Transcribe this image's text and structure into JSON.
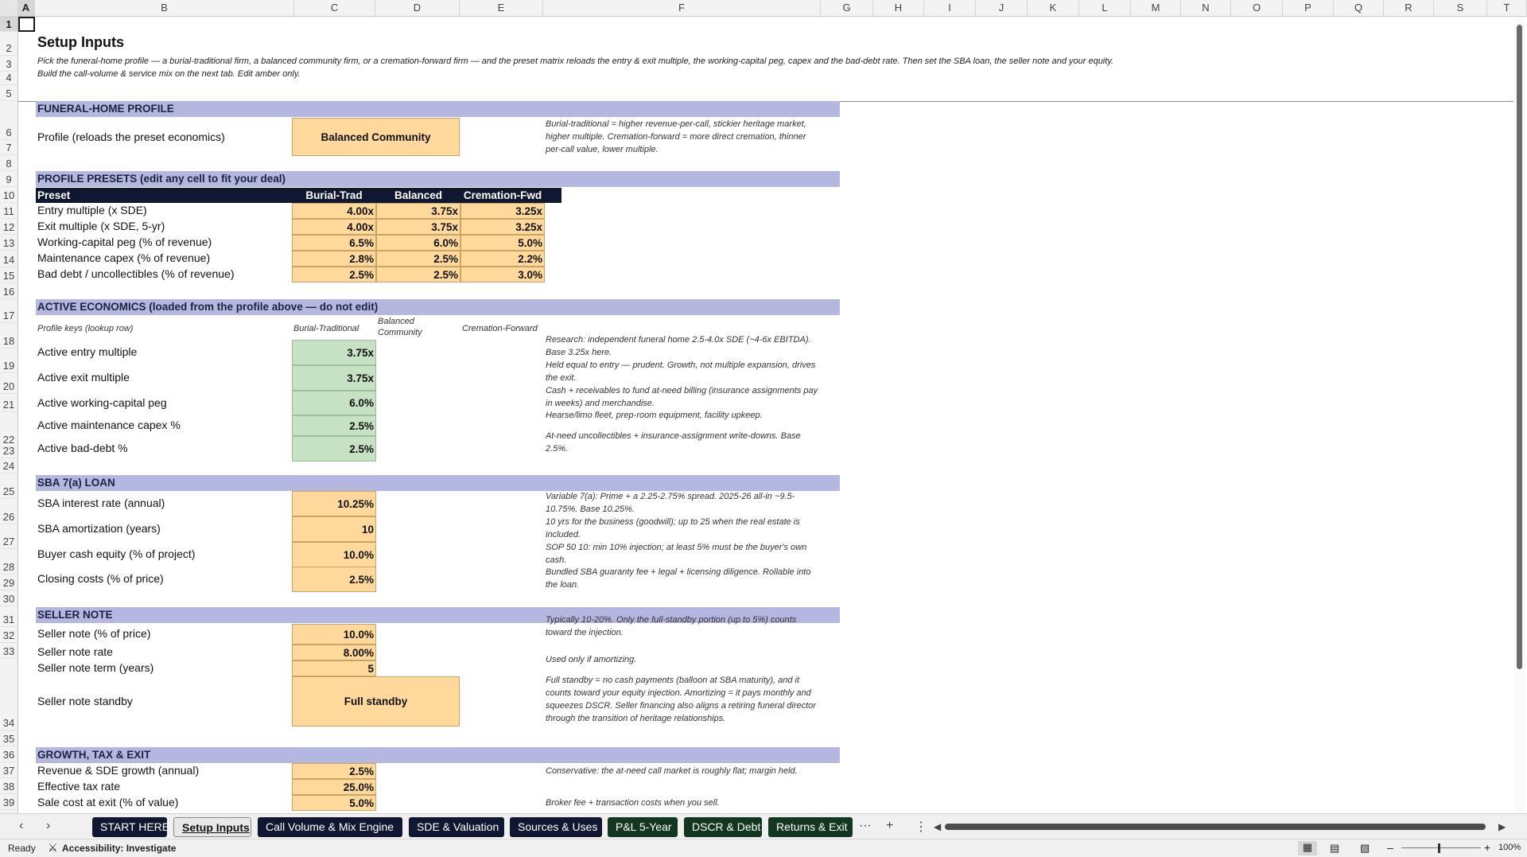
{
  "columns": [
    "A",
    "B",
    "C",
    "D",
    "E",
    "F",
    "G",
    "H",
    "I",
    "J",
    "K",
    "L",
    "M",
    "N",
    "O",
    "P",
    "Q",
    "R",
    "S",
    "T"
  ],
  "rows": [
    "1",
    "2",
    "3",
    "4",
    "5",
    "6",
    "7",
    "8",
    "9",
    "10",
    "11",
    "12",
    "13",
    "14",
    "15",
    "16",
    "17",
    "18",
    "19",
    "20",
    "21",
    "22",
    "23",
    "24",
    "25",
    "26",
    "27",
    "28",
    "29",
    "30",
    "31",
    "32",
    "33",
    "34",
    "35",
    "36",
    "37",
    "38",
    "39"
  ],
  "title": "Setup Inputs",
  "intro_line1": "Pick the funeral-home profile — a burial-traditional firm, a balanced community firm, or a cremation-forward firm — and the preset matrix reloads the entry & exit multiple, the working-capital peg, capex and the bad-debt rate. Then set the SBA loan, the seller note and your equity.",
  "intro_line2": "Build the call-volume & service mix on the next tab. Edit amber only.",
  "profile": {
    "section": "FUNERAL-HOME PROFILE",
    "label": "Profile (reloads the preset economics)",
    "value": "Balanced Community",
    "note": "Burial-traditional = higher revenue-per-call, stickier heritage market, higher multiple. Cremation-forward = more direct cremation, thinner per-call value, lower multiple."
  },
  "presets": {
    "section": "PROFILE PRESETS  (edit any cell to fit your deal)",
    "headers": [
      "Preset",
      "Burial-Trad",
      "Balanced",
      "Cremation-Fwd"
    ],
    "rows": [
      {
        "label": "Entry multiple (x SDE)",
        "values": [
          "4.00x",
          "3.75x",
          "3.25x"
        ]
      },
      {
        "label": "Exit multiple (x SDE, 5-yr)",
        "values": [
          "4.00x",
          "3.75x",
          "3.25x"
        ]
      },
      {
        "label": "Working-capital peg (% of revenue)",
        "values": [
          "6.5%",
          "6.0%",
          "5.0%"
        ]
      },
      {
        "label": "Maintenance capex (% of revenue)",
        "values": [
          "2.8%",
          "2.5%",
          "2.2%"
        ]
      },
      {
        "label": "Bad debt / uncollectibles (% of revenue)",
        "values": [
          "2.5%",
          "2.5%",
          "3.0%"
        ]
      }
    ]
  },
  "active": {
    "section": "ACTIVE ECONOMICS  (loaded from the profile above — do not edit)",
    "keys_label": "Profile keys (lookup row)",
    "keys": [
      "Burial-Traditional",
      "Balanced Community",
      "Cremation-Forward"
    ],
    "rows": [
      {
        "label": "Active entry multiple",
        "value": "3.75x",
        "note": "Research: independent funeral home 2.5-4.0x SDE (~4-6x EBITDA). Base 3.25x here."
      },
      {
        "label": "Active exit multiple",
        "value": "3.75x",
        "note": "Held equal to entry — prudent. Growth, not multiple expansion, drives the exit."
      },
      {
        "label": "Active working-capital peg",
        "value": "6.0%",
        "note": "Cash + receivables to fund at-need billing (insurance assignments pay in weeks) and merchandise."
      },
      {
        "label": "Active maintenance capex %",
        "value": "2.5%",
        "note": "Hearse/limo fleet, prep-room equipment, facility upkeep."
      },
      {
        "label": "Active bad-debt %",
        "value": "2.5%",
        "note": "At-need uncollectibles + insurance-assignment write-downs. Base 2.5%."
      }
    ]
  },
  "sba": {
    "section": "SBA 7(a) LOAN",
    "rows": [
      {
        "label": "SBA interest rate (annual)",
        "value": "10.25%",
        "note": "Variable 7(a): Prime + a 2.25-2.75% spread. 2025-26 all-in ~9.5-10.75%. Base 10.25%."
      },
      {
        "label": "SBA amortization (years)",
        "value": "10",
        "note": "10 yrs for the business (goodwill); up to 25 when the real estate is included."
      },
      {
        "label": "Buyer cash equity (% of project)",
        "value": "10.0%",
        "note": "SOP 50 10: min 10% injection; at least 5% must be the buyer's own cash."
      },
      {
        "label": "Closing costs (% of price)",
        "value": "2.5%",
        "note": "Bundled SBA guaranty fee + legal + licensing diligence. Rollable into the loan."
      }
    ]
  },
  "seller": {
    "section": "SELLER NOTE",
    "rows": [
      {
        "label": "Seller note (% of price)",
        "value": "10.0%",
        "note": "Typically 10-20%. Only the full-standby portion (up to 5%) counts toward the injection."
      },
      {
        "label": "Seller note rate",
        "value": "8.00%",
        "note": ""
      },
      {
        "label": "Seller note term (years)",
        "value": "5",
        "note": "Used only if amortizing."
      },
      {
        "label": "Seller note standby",
        "value": "Full standby",
        "note": "Full standby = no cash payments (balloon at SBA maturity), and it counts toward your equity injection. Amortizing = it pays monthly and squeezes DSCR. Seller financing also aligns a retiring funeral director through the transition of heritage relationships."
      }
    ]
  },
  "growth": {
    "section": "GROWTH, TAX & EXIT",
    "rows": [
      {
        "label": "Revenue & SDE growth (annual)",
        "value": "2.5%",
        "note": "Conservative: the at-need call market is roughly flat; margin held."
      },
      {
        "label": "Effective tax rate",
        "value": "25.0%",
        "note": ""
      },
      {
        "label": "Sale cost at exit (% of value)",
        "value": "5.0%",
        "note": "Broker fee + transaction costs when you sell."
      }
    ]
  },
  "tabs": [
    {
      "label": "START HERE",
      "color": "#0f1731"
    },
    {
      "label": "Setup Inputs",
      "color": "#e8e8e8",
      "active": true
    },
    {
      "label": "Call Volume & Mix Engine",
      "color": "#0f1731"
    },
    {
      "label": "SDE & Valuation",
      "color": "#0f1731"
    },
    {
      "label": "Sources & Uses",
      "color": "#0f1731"
    },
    {
      "label": "P&L 5-Year",
      "color": "#12361f"
    },
    {
      "label": "DSCR & Debt",
      "color": "#12361f"
    },
    {
      "label": "Returns & Exit",
      "color": "#12361f"
    }
  ],
  "tab_more": "···",
  "tab_add": "+",
  "tab_menu": "⋮",
  "status": {
    "ready": "Ready",
    "accessibility": "Accessibility: Investigate",
    "zoom": "100%"
  }
}
